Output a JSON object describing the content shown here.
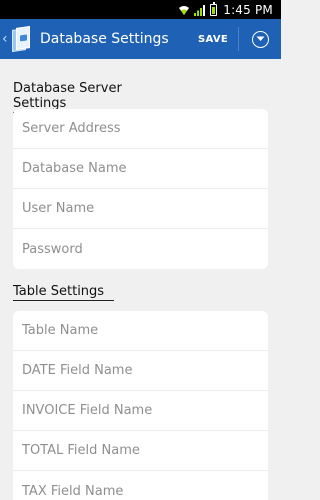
{
  "status_bar": {
    "time": "1:45 PM",
    "icons": [
      "wifi-icon",
      "signal-icon",
      "battery-icon"
    ]
  },
  "action_bar": {
    "title": "Database Settings",
    "save_label": "SAVE",
    "logo_icon": "database-app-icon",
    "overflow_icon": "chevron-down-circle-icon",
    "color": "#1f62b5"
  },
  "sections": {
    "server": {
      "title": "Database Server Settings",
      "fields": {
        "server_address": {
          "placeholder": "Server Address",
          "value": ""
        },
        "database_name": {
          "placeholder": "Database Name",
          "value": ""
        },
        "user_name": {
          "placeholder": "User Name",
          "value": ""
        },
        "password": {
          "placeholder": "Password",
          "value": ""
        }
      }
    },
    "table": {
      "title": "Table Settings",
      "fields": {
        "table_name": {
          "placeholder": "Table Name",
          "value": ""
        },
        "date_field": {
          "placeholder": "DATE Field Name",
          "value": ""
        },
        "invoice_field": {
          "placeholder": "INVOICE Field Name",
          "value": ""
        },
        "total_field": {
          "placeholder": "TOTAL Field Name",
          "value": ""
        },
        "tax_field": {
          "placeholder": "TAX Field Name",
          "value": ""
        }
      }
    }
  }
}
